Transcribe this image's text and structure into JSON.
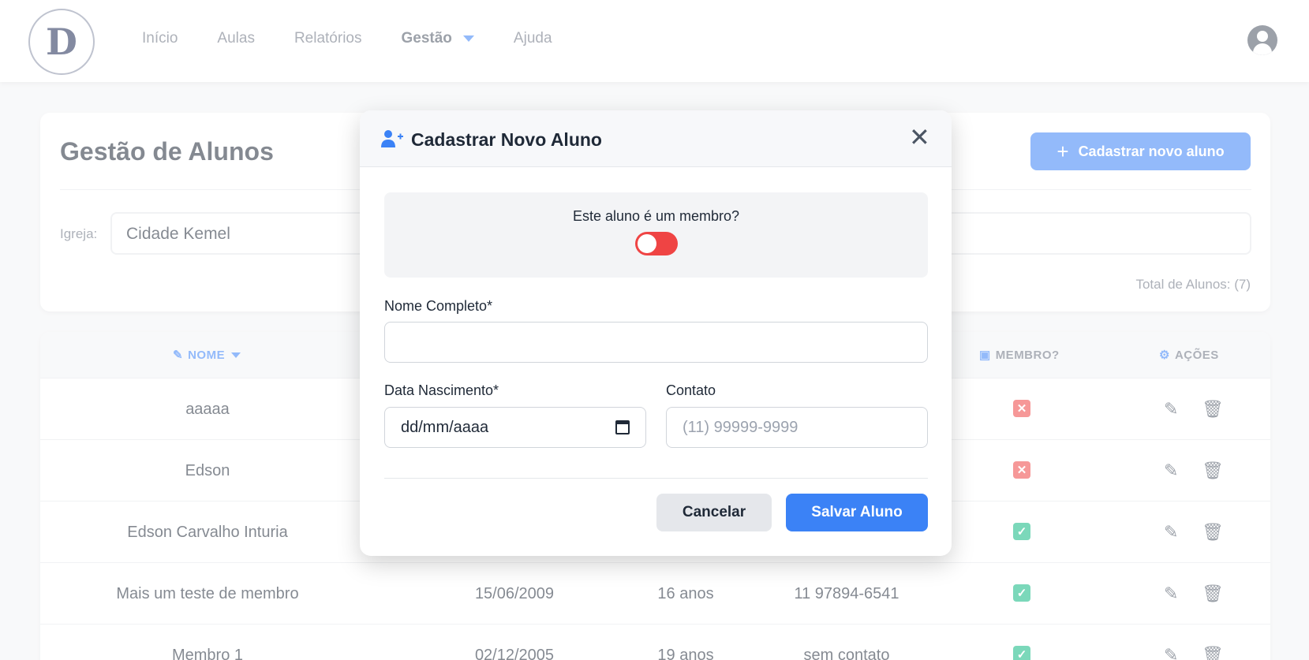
{
  "nav": {
    "logo_text": "D",
    "links": [
      {
        "label": "Início"
      },
      {
        "label": "Aulas"
      },
      {
        "label": "Relatórios"
      },
      {
        "label": "Gestão"
      },
      {
        "label": "Ajuda"
      }
    ]
  },
  "page": {
    "title": "Gestão de Alunos",
    "new_button": "Cadastrar novo aluno",
    "igreja_label": "Igreja:",
    "igreja_value": "Cidade Kemel",
    "total": "Total de Alunos: (7)"
  },
  "table": {
    "headers": {
      "nome": "NOME",
      "membro": "MEMBRO?",
      "acoes": "AÇÕES"
    },
    "rows": [
      {
        "nome": "aaaaa",
        "nascimento": "",
        "idade": "",
        "contato": "",
        "membro": false
      },
      {
        "nome": "Edson",
        "nascimento": "",
        "idade": "",
        "contato": "",
        "membro": false
      },
      {
        "nome": "Edson Carvalho Inturia",
        "nascimento": "",
        "idade": "",
        "contato": "",
        "membro": true
      },
      {
        "nome": "Mais um teste de membro",
        "nascimento": "15/06/2009",
        "idade": "16 anos",
        "contato": "11 97894-6541",
        "membro": true
      },
      {
        "nome": "Membro 1",
        "nascimento": "02/12/2005",
        "idade": "19 anos",
        "contato": "sem contato",
        "membro": true
      }
    ]
  },
  "modal": {
    "title": "Cadastrar Novo Aluno",
    "member_question": "Este aluno é um membro?",
    "member_toggle_on": false,
    "nome_label": "Nome Completo*",
    "nome_value": "",
    "nascimento_label": "Data Nascimento*",
    "nascimento_placeholder": "dd/mm/aaaa",
    "contato_label": "Contato",
    "contato_placeholder": "(11) 99999-9999",
    "cancel": "Cancelar",
    "save": "Salvar Aluno"
  },
  "colors": {
    "accent": "#3b82f6",
    "danger": "#ef4444",
    "success": "#10b981"
  }
}
